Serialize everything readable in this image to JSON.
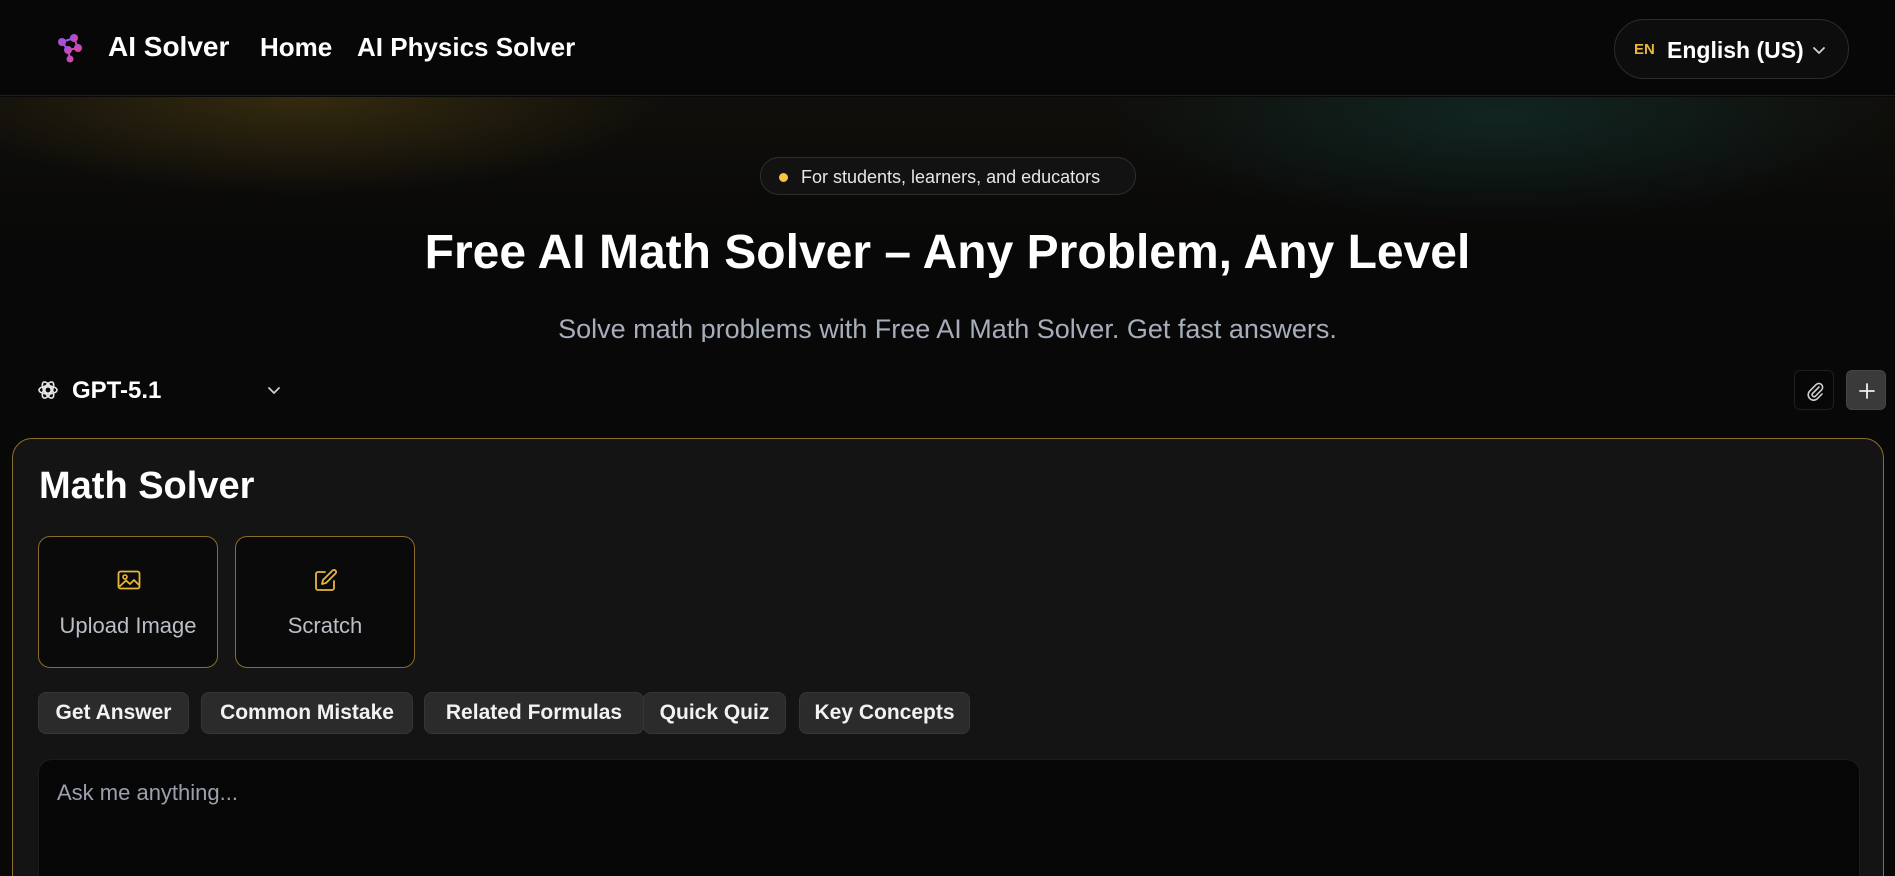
{
  "header": {
    "brand": "AI Solver",
    "nav": [
      {
        "label": "Home"
      },
      {
        "label": "AI Physics Solver"
      }
    ],
    "language": {
      "code": "EN",
      "label": "English (US)"
    }
  },
  "hero": {
    "badge": "For students, learners, and educators",
    "title": "Free AI Math Solver – Any Problem, Any Level",
    "subtitle": "Solve math problems with Free AI Math Solver. Get fast answers."
  },
  "toolbar": {
    "model": "GPT-5.1",
    "attach_icon": "paperclip-icon",
    "new_icon": "plus-icon"
  },
  "solver": {
    "title": "Math Solver",
    "modes": [
      {
        "label": "Upload Image",
        "icon": "image-icon"
      },
      {
        "label": "Scratch",
        "icon": "edit-icon"
      }
    ],
    "quick_actions": [
      {
        "label": "Get Answer"
      },
      {
        "label": "Common Mistake"
      },
      {
        "label": "Related Formulas"
      },
      {
        "label": "Quick Quiz"
      },
      {
        "label": "Key Concepts"
      }
    ],
    "input_placeholder": "Ask me anything..."
  },
  "colors": {
    "accent_gold": "#e8b73a",
    "card_border": "#8a6d2a",
    "background": "#080808"
  }
}
